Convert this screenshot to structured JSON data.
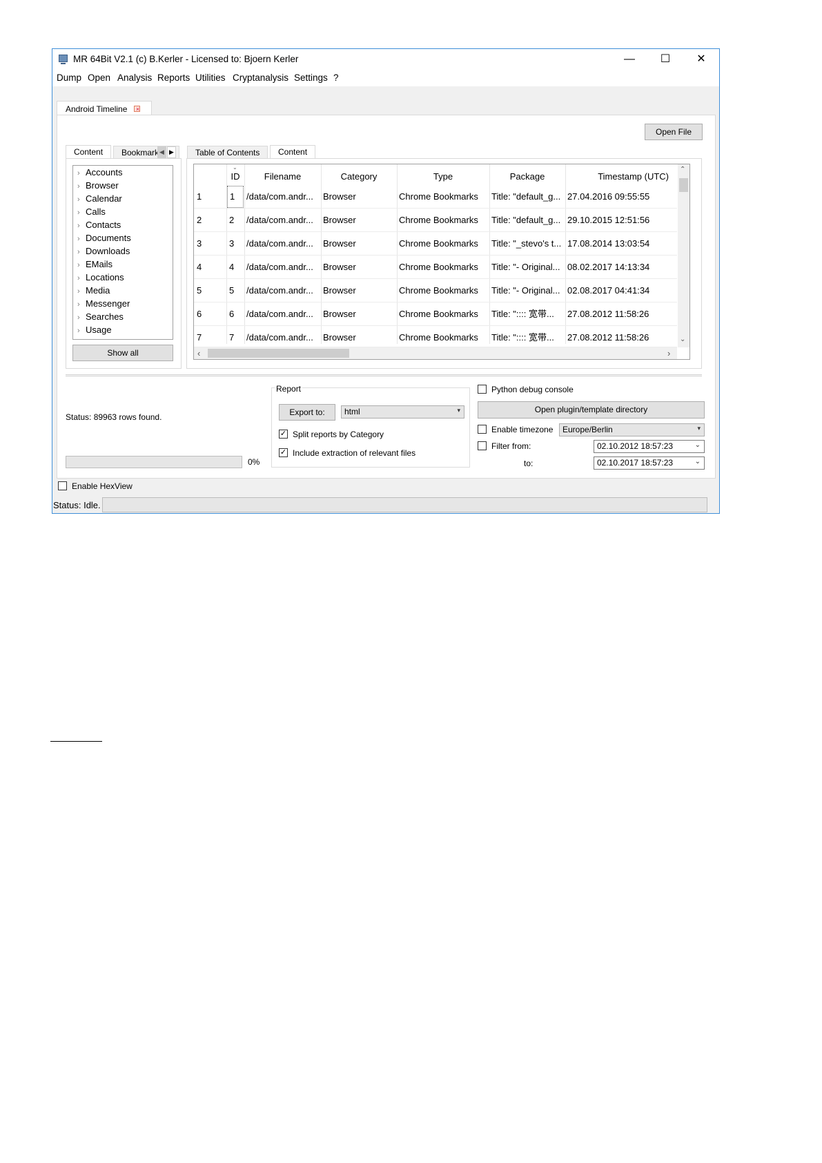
{
  "window": {
    "title": "MR 64Bit V2.1 (c) B.Kerler - Licensed to: Bjoern Kerler",
    "minimize": "—",
    "maximize": "☐",
    "close": "✕"
  },
  "menu": [
    "Dump",
    "Open",
    "Analysis",
    "Reports",
    "Utilities",
    "Cryptanalysis",
    "Settings",
    "?"
  ],
  "top_tab": {
    "label": "Android Timeline"
  },
  "open_file_label": "Open File",
  "left_tabs": {
    "content": "Content",
    "bookmark": "Bookmark"
  },
  "right_tabs": {
    "toc": "Table of Contents",
    "content": "Content"
  },
  "tree": [
    "Accounts",
    "Browser",
    "Calendar",
    "Calls",
    "Contacts",
    "Documents",
    "Downloads",
    "EMails",
    "Locations",
    "Media",
    "Messenger",
    "Searches",
    "Usage"
  ],
  "show_all_label": "Show all",
  "table": {
    "columns": [
      "ID",
      "Filename",
      "Category",
      "Type",
      "Package",
      "Timestamp (UTC)"
    ],
    "rows": [
      {
        "n": "1",
        "id": "1",
        "filename": "/data/com.andr...",
        "category": "Browser",
        "type": "Chrome Bookmarks",
        "package": "Title: \"default_g...",
        "ts": "27.04.2016 09:55:55"
      },
      {
        "n": "2",
        "id": "2",
        "filename": "/data/com.andr...",
        "category": "Browser",
        "type": "Chrome Bookmarks",
        "package": "Title: \"default_g...",
        "ts": "29.10.2015 12:51:56"
      },
      {
        "n": "3",
        "id": "3",
        "filename": "/data/com.andr...",
        "category": "Browser",
        "type": "Chrome Bookmarks",
        "package": "Title: \"_stevo's t...",
        "ts": "17.08.2014 13:03:54"
      },
      {
        "n": "4",
        "id": "4",
        "filename": "/data/com.andr...",
        "category": "Browser",
        "type": "Chrome Bookmarks",
        "package": "Title: \"- Original...",
        "ts": "08.02.2017 14:13:34"
      },
      {
        "n": "5",
        "id": "5",
        "filename": "/data/com.andr...",
        "category": "Browser",
        "type": "Chrome Bookmarks",
        "package": "Title: \"- Original...",
        "ts": "02.08.2017 04:41:34"
      },
      {
        "n": "6",
        "id": "6",
        "filename": "/data/com.andr...",
        "category": "Browser",
        "type": "Chrome Bookmarks",
        "package": "Title: \":::: 宽带...",
        "ts": "27.08.2012 11:58:26"
      },
      {
        "n": "7",
        "id": "7",
        "filename": "/data/com.andr...",
        "category": "Browser",
        "type": "Chrome Bookmarks",
        "package": "Title: \":::: 宽带...",
        "ts": "27.08.2012 11:58:26"
      }
    ]
  },
  "status_rows": "Status: 89963 rows found.",
  "progress": {
    "value": 0,
    "label": "0%"
  },
  "report": {
    "title": "Report",
    "export_label": "Export to:",
    "export_value": "html",
    "split_label": "Split reports by Category",
    "split_checked": true,
    "include_label": "Include extraction of relevant files",
    "include_checked": true
  },
  "right_panel": {
    "python_label": "Python debug console",
    "python_checked": false,
    "plugin_label": "Open plugin/template directory",
    "timezone_label": "Enable timezone",
    "timezone_checked": false,
    "timezone_value": "Europe/Berlin",
    "filter_label": "Filter from:",
    "filter_checked": false,
    "from_value": "02.10.2012 18:57:23",
    "to_label": "to:",
    "to_value": "02.10.2017 18:57:23"
  },
  "hexview_label": "Enable HexView",
  "hexview_checked": false,
  "status_idle": "Status: Idle."
}
